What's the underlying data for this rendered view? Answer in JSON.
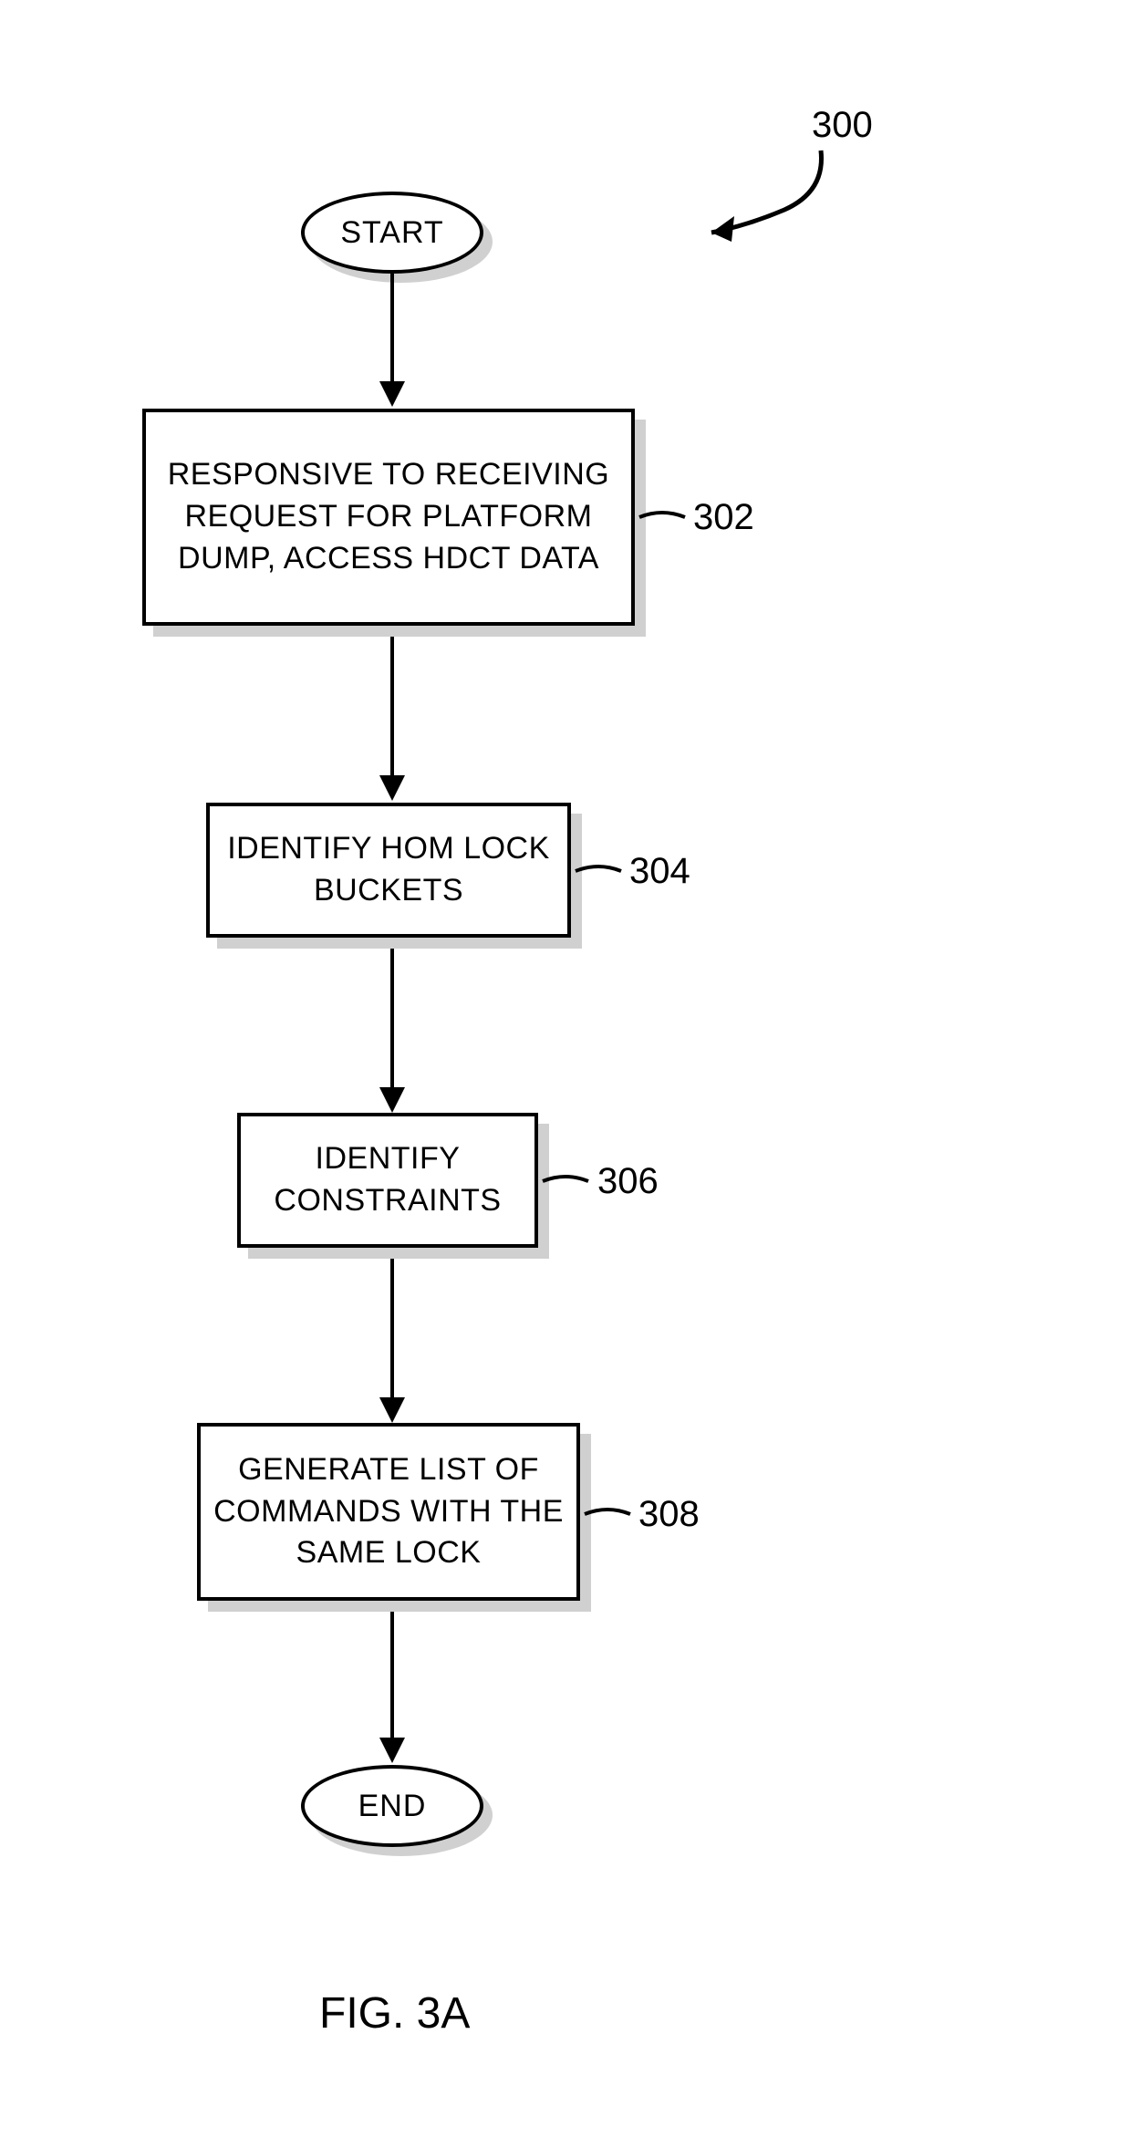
{
  "diagram": {
    "refNumber": "300",
    "start": "START",
    "end": "END",
    "figure": "FIG. 3A",
    "steps": [
      {
        "label": "302",
        "text": "RESPONSIVE TO RECEIVING REQUEST FOR PLATFORM DUMP, ACCESS HDCT DATA"
      },
      {
        "label": "304",
        "text": "IDENTIFY HOM LOCK BUCKETS"
      },
      {
        "label": "306",
        "text": "IDENTIFY CONSTRAINTS"
      },
      {
        "label": "308",
        "text": "GENERATE LIST OF COMMANDS WITH THE SAME LOCK"
      }
    ]
  }
}
